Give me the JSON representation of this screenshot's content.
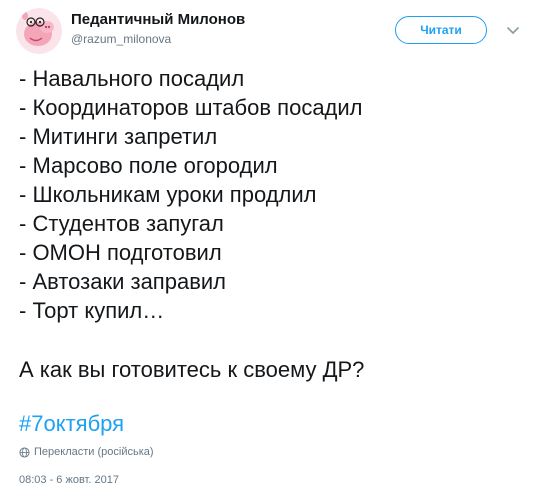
{
  "author": {
    "name": "Педантичный Милонов",
    "handle": "@razum_milonova",
    "avatar_icon": "peppa-pig-avatar-icon"
  },
  "follow_label": "Читати",
  "menu_icon": "chevron-down-icon",
  "tweet_lines": [
    "- Навального посадил",
    "- Координаторов штабов посадил",
    "- Митинги запретил",
    "- Марсово поле огородил",
    "- Школьникам уроки продлил",
    "- Студентов запугал",
    "- ОМОН подготовил",
    "- Автозаки заправил",
    "- Торт купил…"
  ],
  "question": "А как вы готовитесь к своему ДР?",
  "hashtag": "#7октября",
  "translate_label": "Перекласти (російська)",
  "translate_icon": "globe-icon",
  "timestamp": "08:03 - 6 жовт. 2017",
  "colors": {
    "accent": "#1da1f2",
    "text": "#14171a",
    "secondary": "#657786",
    "avatar_pink": "#f4a6b8"
  }
}
